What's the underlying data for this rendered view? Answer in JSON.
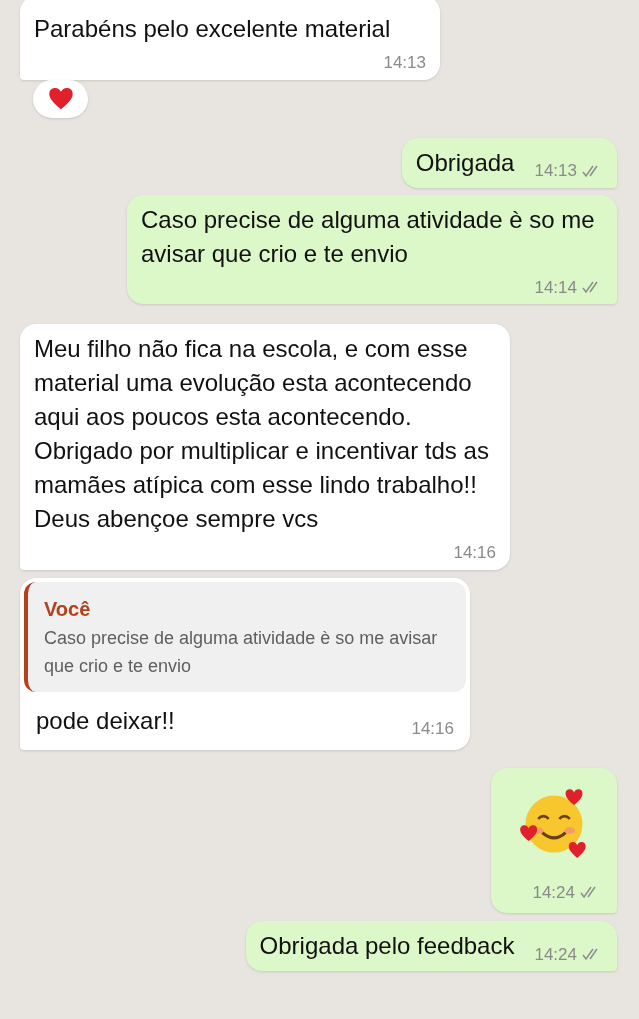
{
  "messages": [
    {
      "kind": "text",
      "outgoing": false,
      "text": "Parabéns pelo excelente material",
      "time": "14:13",
      "has_reaction": true
    },
    {
      "kind": "text",
      "outgoing": true,
      "text": "Obrigada",
      "time": "14:13",
      "read": false
    },
    {
      "kind": "text",
      "outgoing": true,
      "text": "Caso precise de alguma atividade è so me avisar que crio e te envio",
      "time": "14:14",
      "read": false
    },
    {
      "kind": "text",
      "outgoing": false,
      "text": "Meu filho não fica na escola, e com esse material uma evolução esta acontecendo aqui aos poucos esta acontecendo.\nObrigado por multiplicar e incentivar tds as mamães atípica com esse lindo trabalho!!\nDeus abençoe sempre vcs",
      "time": "14:16"
    },
    {
      "kind": "reply",
      "outgoing": false,
      "quote": {
        "author": "Você",
        "text": "Caso precise de alguma atividade è so me avisar que crio e te envio"
      },
      "text": "pode deixar!!",
      "time": "14:16"
    },
    {
      "kind": "emoji",
      "outgoing": true,
      "time": "14:24",
      "read": false
    },
    {
      "kind": "text",
      "outgoing": true,
      "text": "Obrigada pelo feedback",
      "time": "14:24",
      "read": false
    }
  ]
}
